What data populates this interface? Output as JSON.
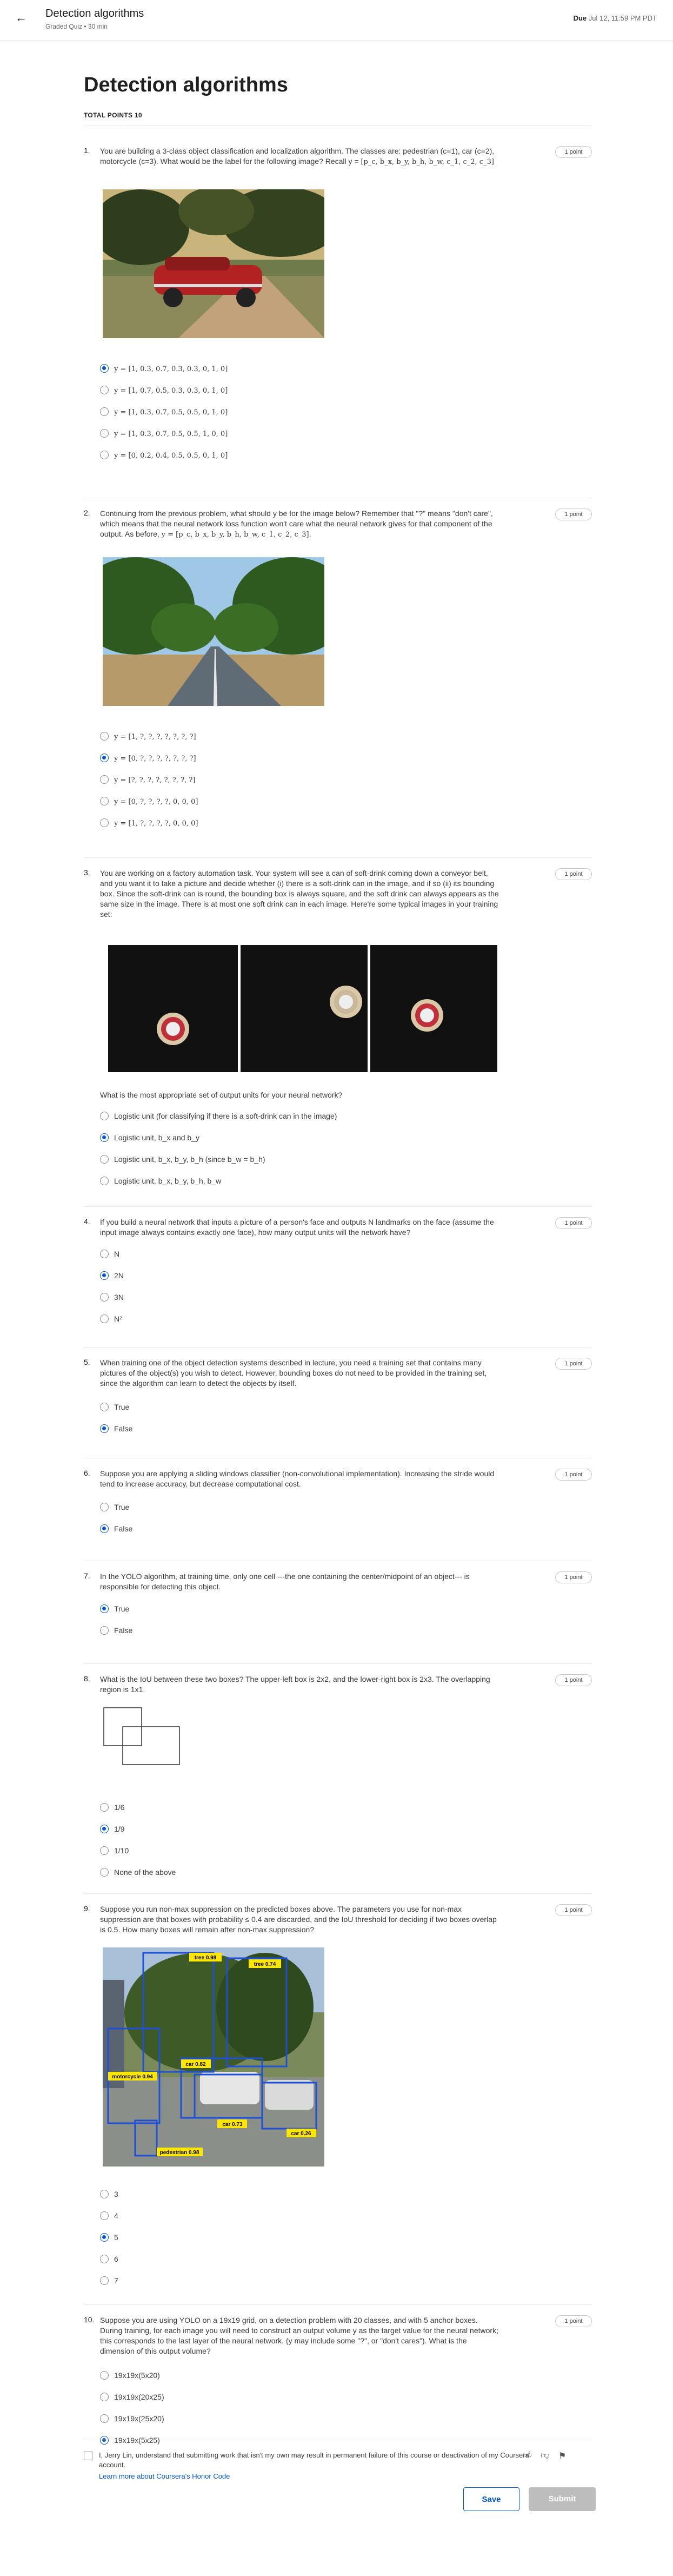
{
  "header": {
    "title": "Detection algorithms",
    "subtitle": "Graded Quiz • 30 min",
    "due_label": "Due",
    "due_value": "Jul 12, 11:59 PM PDT"
  },
  "page": {
    "title": "Detection algorithms",
    "total_points": "TOTAL POINTS 10"
  },
  "questions": [
    {
      "num": "1.",
      "points": "1 point",
      "text": "You are building a 3-class object classification and localization algorithm. The classes are: pedestrian (c=1), car (c=2), motorcycle (c=3). What would be the label for the following image? Recall y =",
      "formula": "[p_c, b_x, b_y, b_h, b_w, c_1, c_2, c_3]",
      "options": [
        "y = [1, 0.3, 0.7, 0.3, 0.3, 0, 1, 0]",
        "y = [1, 0.7, 0.5, 0.3, 0.3, 0, 1, 0]",
        "y = [1, 0.3, 0.7, 0.5, 0.5, 0, 1, 0]",
        "y = [1, 0.3, 0.7, 0.5, 0.5, 1, 0, 0]",
        "y = [0, 0.2, 0.4, 0.5, 0.5, 0, 1, 0]"
      ],
      "selected": 0
    },
    {
      "num": "2.",
      "points": "1 point",
      "text": "Continuing from the previous problem, what should y be for the image below? Remember that \"?\" means \"don't care\", which means that the neural network loss function won't care what the neural network gives for that component of the output. As before,",
      "formula": "y = [p_c, b_x, b_y, b_h, b_w, c_1, c_2, c_3].",
      "options": [
        "y = [1, ?, ?, ?, ?, ?, ?, ?]",
        "y = [0, ?, ?, ?, ?, ?, ?, ?]",
        "y = [?, ?, ?, ?, ?, ?, ?, ?]",
        "y = [0, ?, ?, ?, ?, 0, 0, 0]",
        "y = [1, ?, ?, ?, ?, 0, 0, 0]"
      ],
      "selected": 1
    },
    {
      "num": "3.",
      "points": "1 point",
      "text": "You are working on a factory automation task. Your system will see a can of soft-drink coming down a conveyor belt, and you want it to take a picture and decide whether (i) there is a soft-drink can in the image, and if so (ii) its bounding box. Since the soft-drink can is round, the bounding box is always square, and the soft drink can always appears as the same size in the image. There is at most one soft drink can in each image. Here're some typical images in your training set:",
      "subtext": "What is the most appropriate set of output units for your neural network?",
      "options": [
        "Logistic unit (for classifying if there is a soft-drink can in the image)",
        "Logistic unit, b_x and b_y",
        "Logistic unit, b_x, b_y, b_h (since b_w = b_h)",
        "Logistic unit, b_x, b_y, b_h, b_w"
      ],
      "selected": 1
    },
    {
      "num": "4.",
      "points": "1 point",
      "text": "If you build a neural network that inputs a picture of a person's face and outputs N landmarks on the face (assume the input image always contains exactly one face), how many output units will the network have?",
      "options": [
        "N",
        "2N",
        "3N",
        "N²"
      ],
      "selected": 1
    },
    {
      "num": "5.",
      "points": "1 point",
      "text": "When training one of the object detection systems described in lecture, you need a training set that contains many pictures of the object(s) you wish to detect. However, bounding boxes do not need to be provided in the training set, since the algorithm can learn to detect the objects by itself.",
      "options": [
        "True",
        "False"
      ],
      "selected": 1
    },
    {
      "num": "6.",
      "points": "1 point",
      "text": "Suppose you are applying a sliding windows classifier (non-convolutional implementation). Increasing the stride would tend to increase accuracy, but decrease computational cost.",
      "options": [
        "True",
        "False"
      ],
      "selected": 1
    },
    {
      "num": "7.",
      "points": "1 point",
      "text": "In the YOLO algorithm, at training time, only one cell ---the one containing the center/midpoint of an object--- is responsible for detecting this object.",
      "options": [
        "True",
        "False"
      ],
      "selected": 0
    },
    {
      "num": "8.",
      "points": "1 point",
      "text": "What is the IoU between these two boxes? The upper-left box is 2x2, and the lower-right box is 2x3. The overlapping region is 1x1.",
      "options": [
        "1/6",
        "1/9",
        "1/10",
        "None of the above"
      ],
      "selected": 1
    },
    {
      "num": "9.",
      "points": "1 point",
      "text": "Suppose you run non-max suppression on the predicted boxes above. The parameters you use for non-max suppression are that boxes with probability ≤ 0.4 are discarded, and the IoU threshold for deciding if two boxes overlap is 0.5. How many boxes will remain after non-max suppression?",
      "options": [
        "3",
        "4",
        "5",
        "6",
        "7"
      ],
      "selected": 2,
      "image_labels": [
        "tree 0.98",
        "tree 0.74",
        "car 0.82",
        "motorcycle 0.94",
        "car 0.73",
        "car 0.26",
        "pedestrian 0.98"
      ]
    },
    {
      "num": "10.",
      "points": "1 point",
      "text": "Suppose you are using YOLO on a 19x19 grid, on a detection problem with 20 classes, and with 5 anchor boxes. During training, for each image you will need to construct an output volume y as the target value for the neural network; this corresponds to the last layer of the neural network. (y may include some \"?\", or \"don't cares\"). What is the dimension of this output volume?",
      "options": [
        "19x19x(5x20)",
        "19x19x(20x25)",
        "19x19x(25x20)",
        "19x19x(5x25)"
      ],
      "selected": 3
    }
  ],
  "honor": {
    "text": "I, Jerry Lin, understand that submitting work that isn't my own may result in permanent failure of this course or deactivation of my Coursera account.",
    "link": "Learn more about Coursera's Honor Code"
  },
  "actions": {
    "save": "Save",
    "submit": "Submit"
  },
  "colors": {
    "accent": "#0056d2",
    "disabled": "#bdbdbd"
  }
}
